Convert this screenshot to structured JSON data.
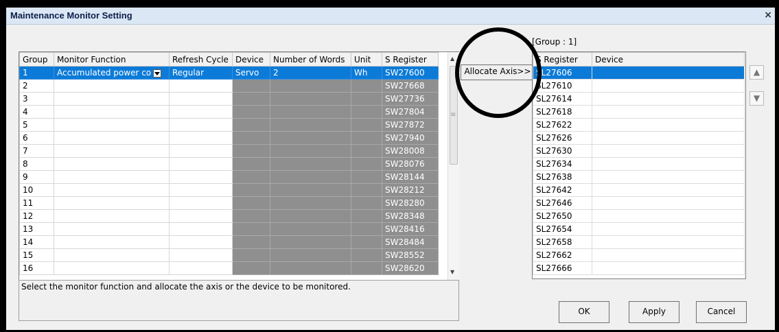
{
  "dialog": {
    "title": "Maintenance Monitor Setting",
    "close": "×"
  },
  "left_table": {
    "headers": [
      "Group",
      "Monitor Function",
      "Refresh Cycle",
      "Device",
      "Number of Words",
      "Unit",
      "S Register"
    ],
    "selected_row": {
      "group": "1",
      "monitor_function": "Accumulated power co",
      "refresh_cycle": "Regular",
      "device": "Servo",
      "number_of_words": "2",
      "unit": "Wh",
      "s_register": "SW27600"
    },
    "rows": [
      {
        "group": "2",
        "s_register": "SW27668"
      },
      {
        "group": "3",
        "s_register": "SW27736"
      },
      {
        "group": "4",
        "s_register": "SW27804"
      },
      {
        "group": "5",
        "s_register": "SW27872"
      },
      {
        "group": "6",
        "s_register": "SW27940"
      },
      {
        "group": "7",
        "s_register": "SW28008"
      },
      {
        "group": "8",
        "s_register": "SW28076"
      },
      {
        "group": "9",
        "s_register": "SW28144"
      },
      {
        "group": "10",
        "s_register": "SW28212"
      },
      {
        "group": "11",
        "s_register": "SW28280"
      },
      {
        "group": "12",
        "s_register": "SW28348"
      },
      {
        "group": "13",
        "s_register": "SW28416"
      },
      {
        "group": "14",
        "s_register": "SW28484"
      },
      {
        "group": "15",
        "s_register": "SW28552"
      },
      {
        "group": "16",
        "s_register": "SW28620"
      }
    ],
    "scrollbar": {
      "up": "▲",
      "grip": "≡",
      "down": "▼"
    }
  },
  "allocate_button": "Allocate Axis>>",
  "group_label": "[Group : 1]",
  "right_table": {
    "headers": [
      "S Register",
      "Device"
    ],
    "selected_index": 0,
    "rows": [
      "SL27606",
      "SL27610",
      "SL27614",
      "SL27618",
      "SL27622",
      "SL27626",
      "SL27630",
      "SL27634",
      "SL27638",
      "SL27642",
      "SL27646",
      "SL27650",
      "SL27654",
      "SL27658",
      "SL27662",
      "SL27666"
    ]
  },
  "move_up": "▲",
  "move_down": "▼",
  "description": "Select the monitor function and allocate the axis or the device to be monitored.",
  "buttons": {
    "ok": "OK",
    "apply": "Apply",
    "cancel": "Cancel"
  },
  "colors": {
    "selection": "#0c7bd8",
    "disabled_cell": "#8f8f8f"
  }
}
